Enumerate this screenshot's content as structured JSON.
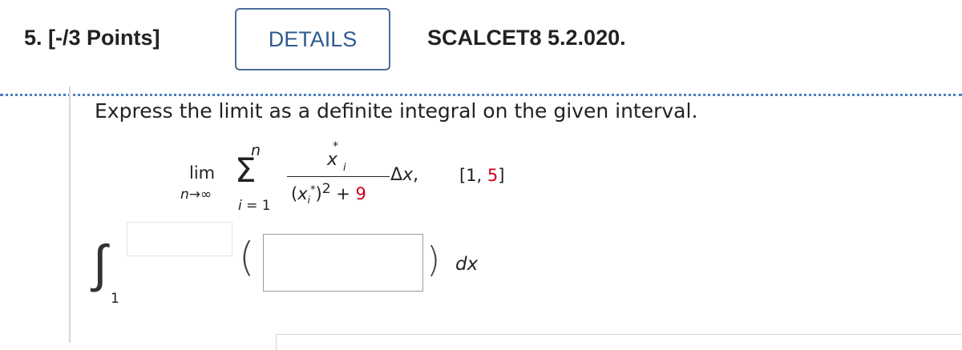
{
  "header": {
    "question_number": "5.",
    "points": "[-/3 Points]",
    "details_label": "DETAILS",
    "problem_code": "SCALCET8 5.2.020."
  },
  "problem": {
    "prompt": "Express the limit as a definite integral on the given interval.",
    "limit": {
      "lim": "lim",
      "under": "n",
      "arrow": "→",
      "inf": "∞"
    },
    "sum": {
      "symbol": "Σ",
      "upper": "n",
      "lower_i": "i",
      "lower_eq": "= 1"
    },
    "fraction": {
      "num_var": "x",
      "num_sub": "i",
      "num_sup": "*",
      "den_open": "(",
      "den_var": "x",
      "den_sub": "i",
      "den_sup": "*",
      "den_close": ")",
      "den_exp": "2",
      "den_plus": "+",
      "den_const": "9"
    },
    "delta": "Δ",
    "delta_var": "x",
    "comma": ",",
    "interval_open": "[1,",
    "interval_end": "5",
    "interval_close": "]"
  },
  "integral": {
    "symbol": "∫",
    "lower_limit": "1",
    "upper_limit_value": "",
    "integrand_value": "",
    "open_paren": "(",
    "close_paren": ")",
    "differential": "dx"
  },
  "colors": {
    "accent_blue": "#2f5b8f",
    "rule_blue": "#4a7fc0",
    "highlight_red": "#d0021b"
  }
}
